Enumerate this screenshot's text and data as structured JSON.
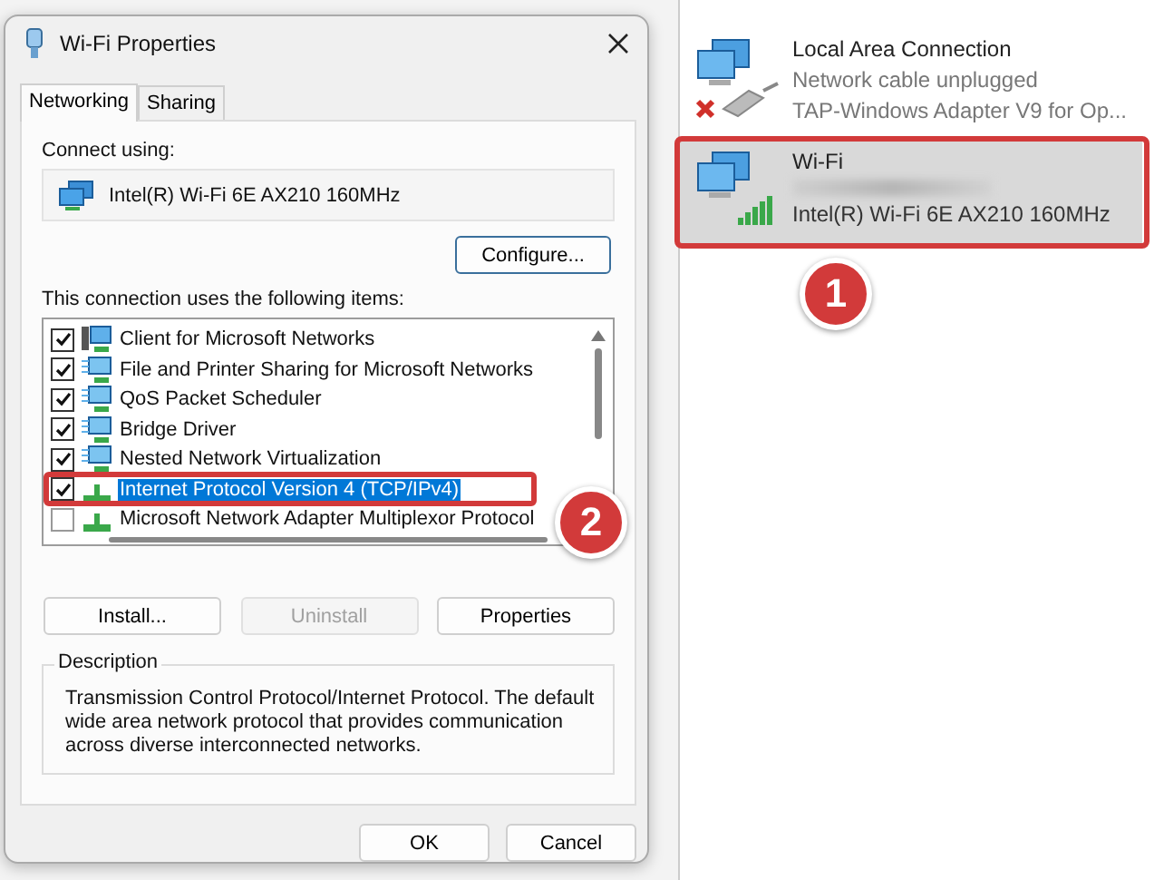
{
  "dialog": {
    "title": "Wi-Fi Properties",
    "tabs": [
      {
        "label": "Networking",
        "selected": true
      },
      {
        "label": "Sharing",
        "selected": false
      }
    ],
    "connect_using_label": "Connect using:",
    "adapter": "Intel(R) Wi-Fi 6E AX210 160MHz",
    "configure_button": "Configure...",
    "items_label": "This connection uses the following items:",
    "items": [
      {
        "label": "Client for Microsoft Networks",
        "checked": true,
        "selected": false,
        "kind": "client"
      },
      {
        "label": "File and Printer Sharing for Microsoft Networks",
        "checked": true,
        "selected": false,
        "kind": "service"
      },
      {
        "label": "QoS Packet Scheduler",
        "checked": true,
        "selected": false,
        "kind": "service"
      },
      {
        "label": "Bridge Driver",
        "checked": true,
        "selected": false,
        "kind": "service"
      },
      {
        "label": "Nested Network Virtualization",
        "checked": true,
        "selected": false,
        "kind": "service"
      },
      {
        "label": "Internet Protocol Version 4 (TCP/IPv4)",
        "checked": true,
        "selected": true,
        "kind": "protocol"
      },
      {
        "label": "Microsoft Network Adapter Multiplexor Protocol",
        "checked": false,
        "selected": false,
        "kind": "protocol"
      }
    ],
    "action_buttons": [
      {
        "label": "Install...",
        "disabled": false
      },
      {
        "label": "Uninstall",
        "disabled": true
      },
      {
        "label": "Properties",
        "disabled": false
      }
    ],
    "description_title": "Description",
    "description": "Transmission Control Protocol/Internet Protocol. The default wide area network protocol that provides communication across diverse interconnected networks.",
    "footer_buttons": [
      "OK",
      "Cancel"
    ]
  },
  "connections": [
    {
      "name": "Local Area Connection",
      "status": "Network cable unplugged",
      "device": "TAP-Windows Adapter V9 for Op...",
      "kind": "wired",
      "selected": false
    },
    {
      "name": "Wi-Fi",
      "device": "Intel(R) Wi-Fi 6E AX210 160MHz",
      "kind": "wireless",
      "selected": true
    }
  ],
  "annotations": [
    {
      "label": "1"
    },
    {
      "label": "2"
    }
  ]
}
